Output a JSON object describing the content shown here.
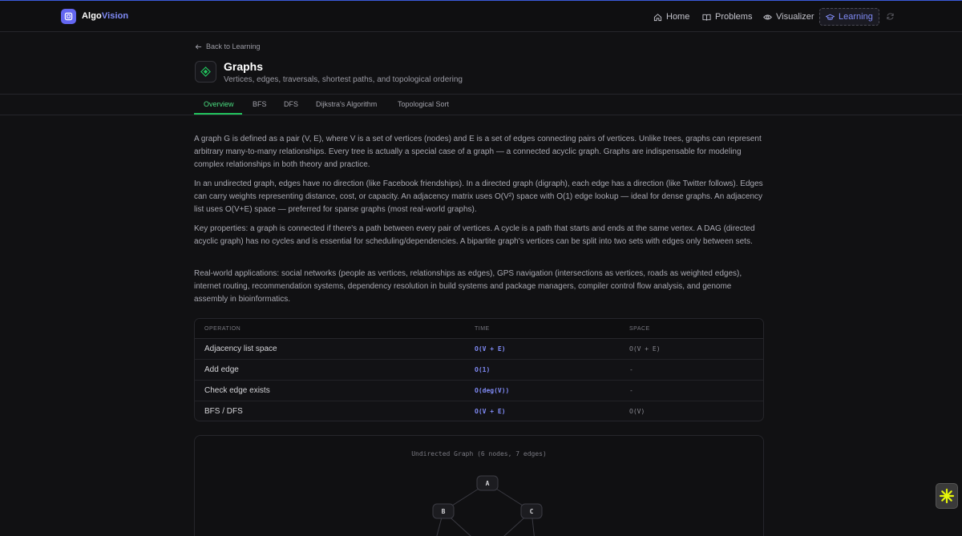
{
  "brand": {
    "part1": "Algo",
    "part2": "Vision"
  },
  "nav": {
    "home": "Home",
    "problems": "Problems",
    "visualizer": "Visualizer",
    "learning": "Learning"
  },
  "header": {
    "back_label": "Back to Learning",
    "title": "Graphs",
    "subtitle": "Vertices, edges, traversals, shortest paths, and topological ordering"
  },
  "tabs": [
    {
      "label": "Overview",
      "active": true
    },
    {
      "label": "BFS",
      "active": false
    },
    {
      "label": "DFS",
      "active": false
    },
    {
      "label": "Dijkstra's Algorithm",
      "active": false
    },
    {
      "label": "Topological Sort",
      "active": false
    }
  ],
  "paragraphs": [
    "A graph G is defined as a pair (V, E), where V is a set of vertices (nodes) and E is a set of edges connecting pairs of vertices. Unlike trees, graphs can represent arbitrary many-to-many relationships. Every tree is actually a special case of a graph — a connected acyclic graph. Graphs are indispensable for modeling complex relationships in both theory and practice.",
    "In an undirected graph, edges have no direction (like Facebook friendships). In a directed graph (digraph), each edge has a direction (like Twitter follows). Edges can carry weights representing distance, cost, or capacity. An adjacency matrix uses O(V²) space with O(1) edge lookup — ideal for dense graphs. An adjacency list uses O(V+E) space — preferred for sparse graphs (most real-world graphs).",
    "Key properties: a graph is connected if there's a path between every pair of vertices. A cycle is a path that starts and ends at the same vertex. A DAG (directed acyclic graph) has no cycles and is essential for scheduling/dependencies. A bipartite graph's vertices can be split into two sets with edges only between sets.",
    "Real-world applications: social networks (people as vertices, relationships as edges), GPS navigation (intersections as vertices, roads as weighted edges), internet routing, recommendation systems, dependency resolution in build systems and package managers, compiler control flow analysis, and genome assembly in bioinformatics."
  ],
  "table": {
    "headers": {
      "operation": "OPERATION",
      "time": "TIME",
      "space": "SPACE"
    },
    "rows": [
      {
        "operation": "Adjacency list space",
        "time": "O(V + E)",
        "space": "O(V + E)"
      },
      {
        "operation": "Add edge",
        "time": "O(1)",
        "space": "-"
      },
      {
        "operation": "Check edge exists",
        "time": "O(deg(V))",
        "space": "-"
      },
      {
        "operation": "BFS / DFS",
        "time": "O(V + E)",
        "space": "O(V)"
      }
    ]
  },
  "graph": {
    "title": "Undirected Graph (6 nodes, 7 edges)",
    "nodes": [
      "A",
      "B",
      "C"
    ]
  },
  "colors": {
    "accent": "#818cf8",
    "brand": "#6366f1",
    "active_tab": "#4ade80"
  }
}
